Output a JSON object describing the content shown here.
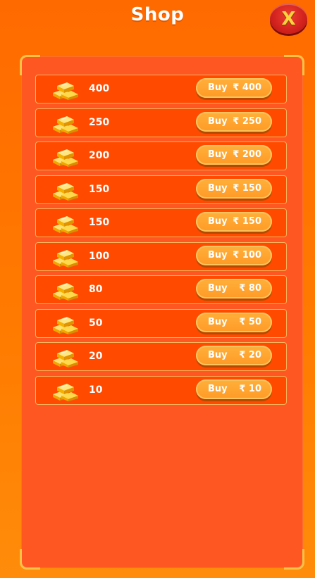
{
  "header": {
    "title": "Shop",
    "close_label": "X"
  },
  "colors": {
    "background": "#ff6a00",
    "panel": "#ff5722",
    "row": "#ff4a00",
    "row_border": "#ffb35c",
    "button": "#ffa02c",
    "close_button": "#d42a22",
    "close_glyph": "#ffd23e",
    "gold": "#ffc71f"
  },
  "shop": {
    "items": [
      {
        "icon": "gold-bars-icon",
        "amount": "400",
        "buy_label": "Buy",
        "price": "₹ 400"
      },
      {
        "icon": "gold-bars-icon",
        "amount": "250",
        "buy_label": "Buy",
        "price": "₹ 250"
      },
      {
        "icon": "gold-bars-icon",
        "amount": "200",
        "buy_label": "Buy",
        "price": "₹ 200"
      },
      {
        "icon": "gold-bars-icon",
        "amount": "150",
        "buy_label": "Buy",
        "price": "₹ 150"
      },
      {
        "icon": "gold-bars-icon",
        "amount": "150",
        "buy_label": "Buy",
        "price": "₹ 150"
      },
      {
        "icon": "gold-bars-icon",
        "amount": "100",
        "buy_label": "Buy",
        "price": "₹ 100"
      },
      {
        "icon": "gold-bars-icon",
        "amount": "80",
        "buy_label": "Buy",
        "price": "₹ 80"
      },
      {
        "icon": "gold-bars-icon",
        "amount": "50",
        "buy_label": "Buy",
        "price": "₹ 50"
      },
      {
        "icon": "gold-bars-icon",
        "amount": "20",
        "buy_label": "Buy",
        "price": "₹ 20"
      },
      {
        "icon": "gold-bars-icon",
        "amount": "10",
        "buy_label": "Buy",
        "price": "₹ 10"
      }
    ]
  }
}
